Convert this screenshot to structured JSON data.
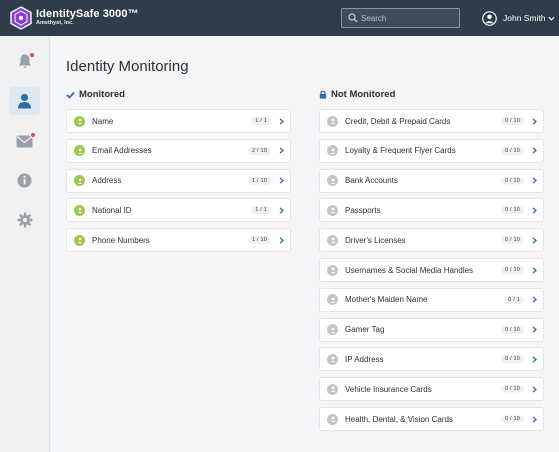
{
  "app": {
    "title": "IdentitySafe 3000™",
    "subtitle": "Amethyst, Inc."
  },
  "search": {
    "placeholder": "Search",
    "value": ""
  },
  "user": {
    "name": "John Smith"
  },
  "colors": {
    "header": "#2f3d4b",
    "accent": "#2e6fa8",
    "monitored_icon": "#9cc94a",
    "unmonitored_icon": "#c2c6cc",
    "notification_dot": "#d9534a",
    "logo": "#8a3fd1"
  },
  "sidebar": {
    "items": [
      {
        "name": "notifications",
        "icon": "bell-icon",
        "active": false,
        "has_dot": true
      },
      {
        "name": "identity",
        "icon": "user-icon",
        "active": true,
        "has_dot": false
      },
      {
        "name": "messages",
        "icon": "envelope-icon",
        "active": false,
        "has_dot": true
      },
      {
        "name": "info",
        "icon": "info-icon",
        "active": false,
        "has_dot": false
      },
      {
        "name": "settings",
        "icon": "gear-icon",
        "active": false,
        "has_dot": false
      }
    ]
  },
  "page": {
    "title": "Identity Monitoring"
  },
  "monitored": {
    "heading": "Monitored",
    "items": [
      {
        "label": "Name",
        "count": "1 / 1",
        "icon": "user-icon"
      },
      {
        "label": "Email Addresses",
        "count": "2 / 10",
        "icon": "at-icon"
      },
      {
        "label": "Address",
        "count": "1 / 10",
        "icon": "home-icon"
      },
      {
        "label": "National ID",
        "count": "1 / 1",
        "icon": "id-icon"
      },
      {
        "label": "Phone Numbers",
        "count": "1 / 10",
        "icon": "phone-icon"
      }
    ]
  },
  "not_monitored": {
    "heading": "Not Monitored",
    "items": [
      {
        "label": "Credit, Debit & Prepaid Cards",
        "count": "0 / 10",
        "icon": "card-icon"
      },
      {
        "label": "Loyalty & Frequent Flyer Cards",
        "count": "0 / 10",
        "icon": "plus-icon"
      },
      {
        "label": "Bank Accounts",
        "count": "0 / 10",
        "icon": "bank-icon"
      },
      {
        "label": "Passports",
        "count": "0 / 10",
        "icon": "passport-icon"
      },
      {
        "label": "Driver's Licenses",
        "count": "0 / 10",
        "icon": "license-icon"
      },
      {
        "label": "Usernames & Social Media Handles",
        "count": "0 / 10",
        "icon": "social-icon"
      },
      {
        "label": "Mother's Maiden Name",
        "count": "0 / 1",
        "icon": "person-icon"
      },
      {
        "label": "Gamer Tag",
        "count": "0 / 10",
        "icon": "gamepad-icon"
      },
      {
        "label": "IP Address",
        "count": "0 / 10",
        "icon": "ip-icon"
      },
      {
        "label": "Vehicle Insurance Cards",
        "count": "0 / 10",
        "icon": "vehicle-icon"
      },
      {
        "label": "Health, Dental, & Vision Cards",
        "count": "0 / 10",
        "icon": "health-icon"
      }
    ]
  }
}
